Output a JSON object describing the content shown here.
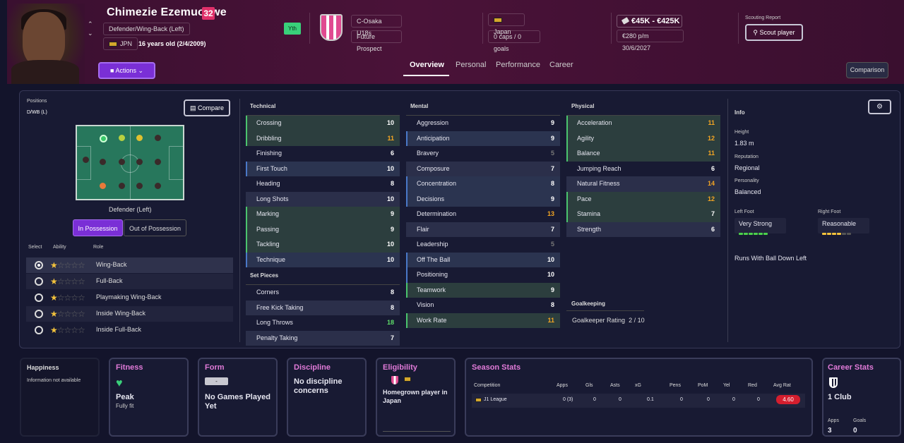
{
  "header": {
    "name": "Chimezie Ezemuokwe",
    "number": "32",
    "position": "Defender/Wing-Back (Left)",
    "nationality_code": "JPN",
    "age": "16 years old (2/4/2009)",
    "youth_badge": "Yth",
    "club": "C-Osaka U18s",
    "status": "Future Prospect",
    "nation": "Japan",
    "caps": "0 caps / 0 goals",
    "value": "€45K - €425K",
    "wage": "€280 p/m  30/6/2027",
    "scouting_label": "Scouting Report",
    "scout_button": "Scout player",
    "actions_button": "Actions",
    "comparison_button": "Comparison",
    "tabs": [
      "Overview",
      "Personal",
      "Performance",
      "Career"
    ]
  },
  "positions": {
    "label": "Positions",
    "value": "D/WB (L)",
    "compare_button": "Compare",
    "pitch_label": "Defender (Left)",
    "possession_tabs": [
      "In Possession",
      "Out of Possession"
    ],
    "headers": [
      "Select",
      "Ability",
      "Role"
    ],
    "roles": [
      {
        "name": "Wing-Back",
        "stars": 1,
        "selected": true
      },
      {
        "name": "Full-Back",
        "stars": 1,
        "selected": false
      },
      {
        "name": "Playmaking Wing-Back",
        "stars": 1,
        "selected": false
      },
      {
        "name": "Inside Wing-Back",
        "stars": 1,
        "selected": false
      },
      {
        "name": "Inside Full-Back",
        "stars": 1,
        "selected": false
      }
    ]
  },
  "technical": {
    "title": "Technical",
    "attrs": [
      {
        "name": "Crossing",
        "value": "10"
      },
      {
        "name": "Dribbling",
        "value": "11"
      },
      {
        "name": "Finishing",
        "value": "6"
      },
      {
        "name": "First Touch",
        "value": "10"
      },
      {
        "name": "Heading",
        "value": "8"
      },
      {
        "name": "Long Shots",
        "value": "10"
      },
      {
        "name": "Marking",
        "value": "9"
      },
      {
        "name": "Passing",
        "value": "9"
      },
      {
        "name": "Tackling",
        "value": "10"
      },
      {
        "name": "Technique",
        "value": "10"
      }
    ],
    "set_pieces_title": "Set Pieces",
    "set_pieces": [
      {
        "name": "Corners",
        "value": "8"
      },
      {
        "name": "Free Kick Taking",
        "value": "8"
      },
      {
        "name": "Long Throws",
        "value": "18"
      },
      {
        "name": "Penalty Taking",
        "value": "7"
      }
    ]
  },
  "mental": {
    "title": "Mental",
    "attrs": [
      {
        "name": "Aggression",
        "value": "9"
      },
      {
        "name": "Anticipation",
        "value": "9"
      },
      {
        "name": "Bravery",
        "value": "5"
      },
      {
        "name": "Composure",
        "value": "7"
      },
      {
        "name": "Concentration",
        "value": "8"
      },
      {
        "name": "Decisions",
        "value": "9"
      },
      {
        "name": "Determination",
        "value": "13"
      },
      {
        "name": "Flair",
        "value": "7"
      },
      {
        "name": "Leadership",
        "value": "5"
      },
      {
        "name": "Off The Ball",
        "value": "10"
      },
      {
        "name": "Positioning",
        "value": "10"
      },
      {
        "name": "Teamwork",
        "value": "9"
      },
      {
        "name": "Vision",
        "value": "8"
      },
      {
        "name": "Work Rate",
        "value": "11"
      }
    ]
  },
  "physical": {
    "title": "Physical",
    "attrs": [
      {
        "name": "Acceleration",
        "value": "11"
      },
      {
        "name": "Agility",
        "value": "12"
      },
      {
        "name": "Balance",
        "value": "11"
      },
      {
        "name": "Jumping Reach",
        "value": "6"
      },
      {
        "name": "Natural Fitness",
        "value": "14"
      },
      {
        "name": "Pace",
        "value": "12"
      },
      {
        "name": "Stamina",
        "value": "7"
      },
      {
        "name": "Strength",
        "value": "6"
      }
    ],
    "goalkeeping_title": "Goalkeeping",
    "gk_label": "Goalkeeper Rating",
    "gk_value": "2 / 10"
  },
  "info": {
    "title": "Info",
    "height_label": "Height",
    "height": "1.83 m",
    "reputation_label": "Reputation",
    "reputation": "Regional",
    "personality_label": "Personality",
    "personality": "Balanced",
    "left_foot_label": "Left Foot",
    "left_foot": "Very Strong",
    "right_foot_label": "Right Foot",
    "right_foot": "Reasonable",
    "trait": "Runs With Ball Down Left"
  },
  "bottom": {
    "happiness_title": "Happiness",
    "happiness_text": "Information not available",
    "fitness_title": "Fitness",
    "fitness_value": "Peak",
    "fitness_sub": "Fully fit",
    "form_title": "Form",
    "form_badge": "-",
    "form_text": "No Games Played Yet",
    "discipline_title": "Discipline",
    "discipline_text": "No discipline concerns",
    "eligibility_title": "Eligibility",
    "eligibility_text": "Homegrown player in Japan",
    "season_title": "Season Stats",
    "season_headers": [
      "Competition",
      "Apps",
      "Gls",
      "Asts",
      "xG",
      "Pens",
      "PoM",
      "Yel",
      "Red",
      "Avg Rat"
    ],
    "season_row": [
      "J1 League",
      "0 (3)",
      "0",
      "0",
      "0.1",
      "0",
      "0",
      "0",
      "0",
      "4.60"
    ],
    "career_title": "Career Stats",
    "career_clubs": "1 Club",
    "career_apps_label": "Apps",
    "career_apps": "3",
    "career_goals_label": "Goals",
    "career_goals": "0"
  },
  "colors": {
    "accent": "#7a2fd6",
    "pink": "#e0306a",
    "good": "#4bc46e",
    "orange": "#f5a623"
  }
}
